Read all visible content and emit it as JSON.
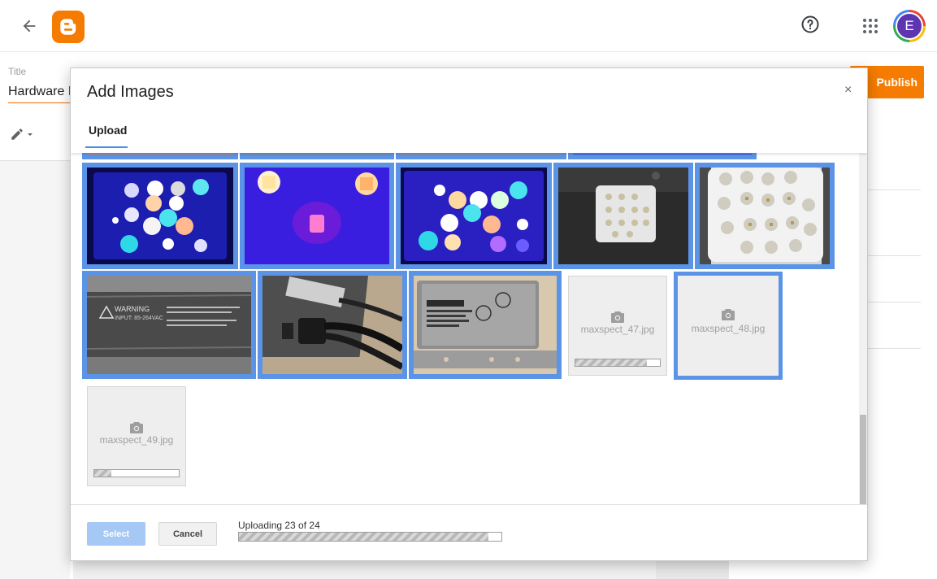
{
  "app": {
    "title_label": "Title",
    "post_title": "Hardware I",
    "publish_label": "Publish",
    "avatar_initial": "E"
  },
  "dialog": {
    "title": "Add Images",
    "close_symbol": "×",
    "tab_upload": "Upload",
    "select_label": "Select",
    "cancel_label": "Cancel",
    "upload_status": "Uploading 23 of 24",
    "upload_progress": 0.95
  },
  "placeholders": [
    {
      "filename": "maxspect_47.jpg",
      "progress": 0.85,
      "selected": false
    },
    {
      "filename": "maxspect_48.jpg",
      "progress": null,
      "selected": true
    },
    {
      "filename": "maxspect_49.jpg",
      "progress": 0.2,
      "selected": false
    }
  ],
  "warning_label": {
    "line1": "WARNING",
    "line2": "INPUT: 85-264VAC"
  },
  "colors": {
    "brand": "#f57c00",
    "selection": "#5b94e6",
    "select_disabled": "#a6c8f5",
    "avatar": "#5e35b1"
  },
  "icons": [
    "back-arrow-icon",
    "blogger-logo-icon",
    "help-icon",
    "apps-grid-icon",
    "pencil-icon",
    "camera-icon",
    "close-icon"
  ]
}
